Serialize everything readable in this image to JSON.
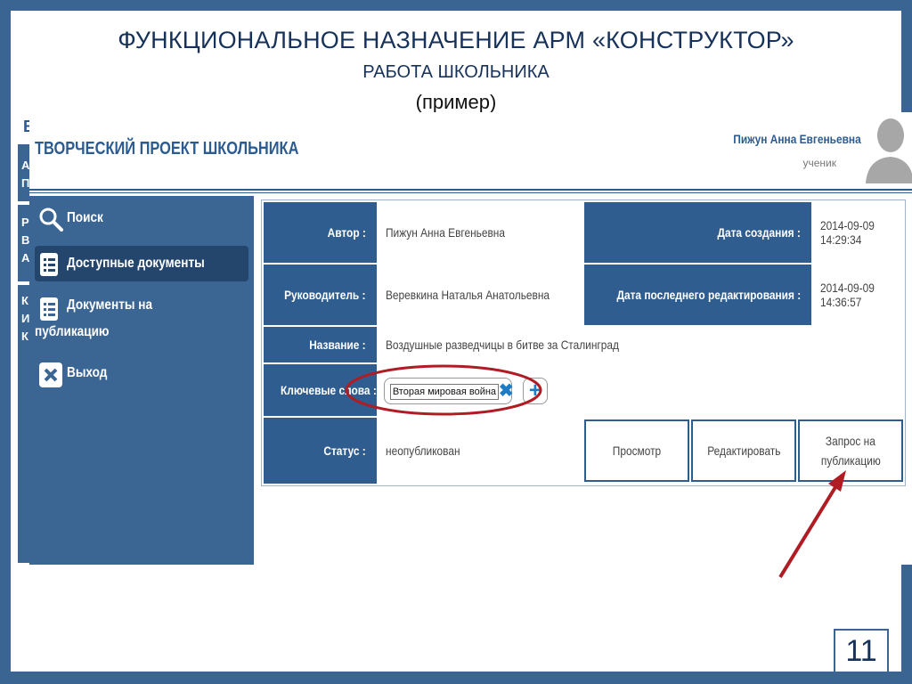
{
  "slide": {
    "title": "ФУНКЦИОНАЛЬНОЕ НАЗНАЧЕНИЕ АРМ «КОНСТРУКТОР»",
    "subtitle": "РАБОТА ШКОЛЬНИКА",
    "example": "(пример)",
    "page_number": "11"
  },
  "background_app": {
    "letters": [
      "В",
      "А",
      "П",
      "Р",
      "В",
      "А",
      "К",
      "И",
      "К"
    ]
  },
  "app": {
    "title": "ТВОРЧЕСКИЙ ПРОЕКТ ШКОЛЬНИКА",
    "user": {
      "name": "Пижун Анна Евгеньевна",
      "role": "ученик"
    },
    "sidebar": {
      "items": [
        {
          "label": "Поиск",
          "icon": "search-icon"
        },
        {
          "label": "Доступные документы",
          "icon": "document-list-icon",
          "active": true
        },
        {
          "label_line1": "Документы на",
          "label_line2": "публикацию",
          "icon": "document-list-icon"
        },
        {
          "label": "Выход",
          "icon": "close-icon"
        }
      ]
    },
    "details": {
      "author_label": "Автор :",
      "author_value": "Пижун Анна Евгеньевна",
      "created_label": "Дата создания :",
      "created_date": "2014-09-09",
      "created_time": "14:29:34",
      "supervisor_label": "Руководитель :",
      "supervisor_value": "Веревкина Наталья Анатольевна",
      "edited_label": "Дата последнего редактирования :",
      "edited_date": "2014-09-09",
      "edited_time": "14:36:57",
      "name_label": "Название :",
      "name_value": "Воздушные разведчицы в битве за Сталинград",
      "keywords_label": "Ключевые слова :",
      "keyword_value": "Вторая мировая война",
      "status_label": "Статус :",
      "status_value": "неопубликован"
    },
    "buttons": {
      "view": "Просмотр",
      "edit": "Редактировать",
      "publish_line1": "Запрос на",
      "publish_line2": "публикацию"
    }
  },
  "colors": {
    "frame": "#3a6491",
    "label_cell": "#2f5d8f",
    "annotation": "#b01c24",
    "accent_icon": "#1e7cc4"
  }
}
